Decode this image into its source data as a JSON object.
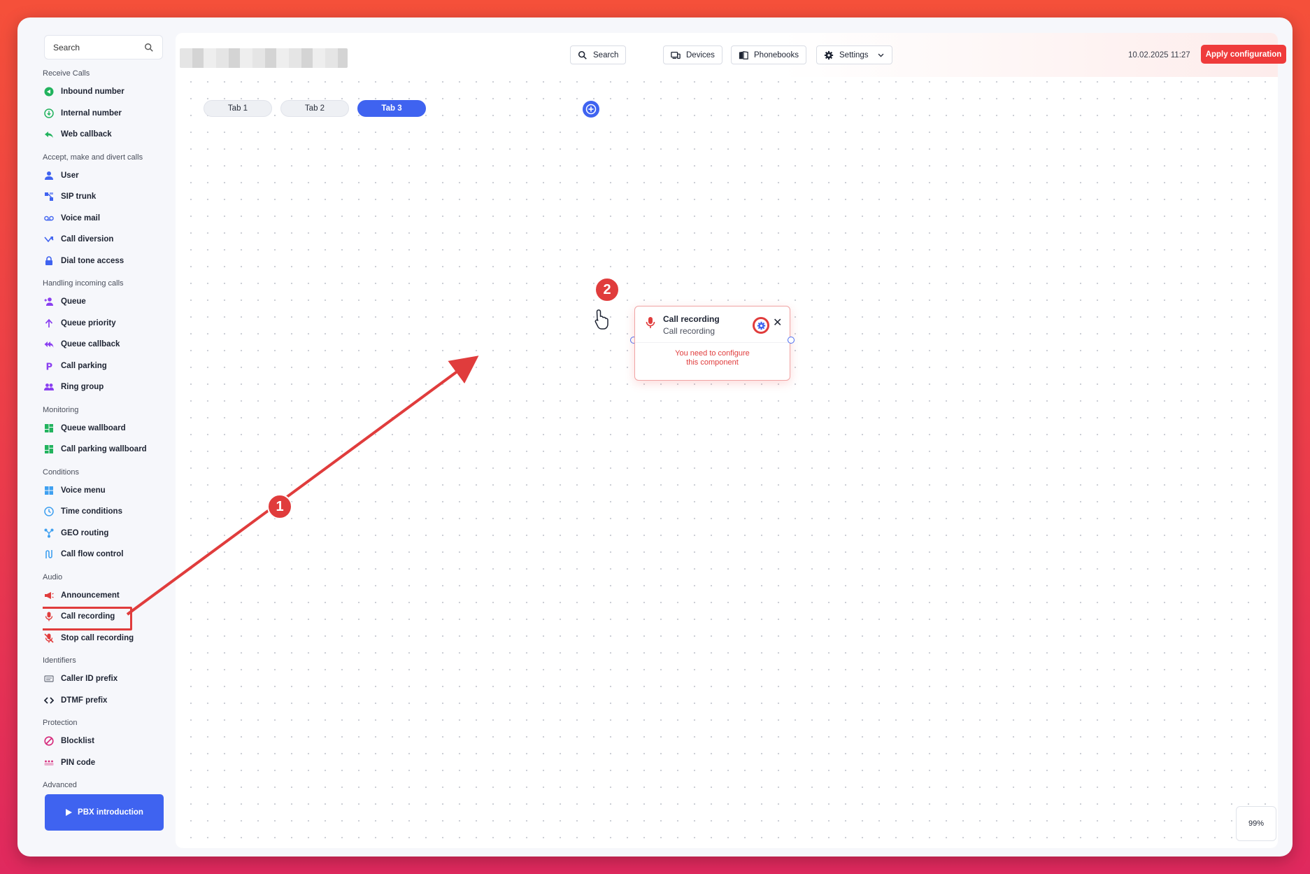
{
  "sidebar": {
    "search_placeholder": "Search",
    "sections": [
      {
        "title": "Receive Calls",
        "items": [
          {
            "label": "Inbound number",
            "icon": "inbound-number-icon",
            "color": "#22b35e"
          },
          {
            "label": "Internal number",
            "icon": "internal-number-icon",
            "color": "#22b35e"
          },
          {
            "label": "Web callback",
            "icon": "web-callback-icon",
            "color": "#22b35e"
          }
        ]
      },
      {
        "title": "Accept, make and divert calls",
        "items": [
          {
            "label": "User",
            "icon": "user-icon",
            "color": "#3f63f0"
          },
          {
            "label": "SIP trunk",
            "icon": "sip-trunk-icon",
            "color": "#3f63f0"
          },
          {
            "label": "Voice mail",
            "icon": "voice-mail-icon",
            "color": "#3f63f0"
          },
          {
            "label": "Call diversion",
            "icon": "call-diversion-icon",
            "color": "#3f63f0"
          },
          {
            "label": "Dial tone access",
            "icon": "lock-icon",
            "color": "#3f63f0"
          }
        ]
      },
      {
        "title": "Handling incoming calls",
        "items": [
          {
            "label": "Queue",
            "icon": "queue-icon",
            "color": "#8a3ff0"
          },
          {
            "label": "Queue priority",
            "icon": "queue-priority-icon",
            "color": "#8a3ff0"
          },
          {
            "label": "Queue callback",
            "icon": "queue-callback-icon",
            "color": "#8a3ff0"
          },
          {
            "label": "Call parking",
            "icon": "call-parking-icon",
            "color": "#8a3ff0"
          },
          {
            "label": "Ring group",
            "icon": "ring-group-icon",
            "color": "#8a3ff0"
          }
        ]
      },
      {
        "title": "Monitoring",
        "items": [
          {
            "label": "Queue wallboard",
            "icon": "wallboard-icon",
            "color": "#22b35e"
          },
          {
            "label": "Call parking wallboard",
            "icon": "wallboard-icon",
            "color": "#22b35e"
          }
        ]
      },
      {
        "title": "Conditions",
        "items": [
          {
            "label": "Voice menu",
            "icon": "voice-menu-icon",
            "color": "#3fa0f0"
          },
          {
            "label": "Time conditions",
            "icon": "clock-icon",
            "color": "#3fa0f0"
          },
          {
            "label": "GEO routing",
            "icon": "geo-routing-icon",
            "color": "#3fa0f0"
          },
          {
            "label": "Call flow control",
            "icon": "call-flow-control-icon",
            "color": "#3fa0f0"
          }
        ]
      },
      {
        "title": "Audio",
        "items": [
          {
            "label": "Announcement",
            "icon": "megaphone-icon",
            "color": "#e03c3c"
          },
          {
            "label": "Call recording",
            "icon": "microphone-icon",
            "color": "#e03c3c",
            "highlight": true
          },
          {
            "label": "Stop call recording",
            "icon": "microphone-off-icon",
            "color": "#e03c3c"
          }
        ]
      },
      {
        "title": "Identifiers",
        "items": [
          {
            "label": "Caller ID prefix",
            "icon": "caller-id-prefix-icon",
            "color": "#6a6f7c"
          },
          {
            "label": "DTMF prefix",
            "icon": "code-brackets-icon",
            "color": "#1e2433"
          }
        ]
      },
      {
        "title": "Protection",
        "items": [
          {
            "label": "Blocklist",
            "icon": "block-icon",
            "color": "#d6287a"
          },
          {
            "label": "PIN code",
            "icon": "pin-code-icon",
            "color": "#d6287a"
          }
        ]
      },
      {
        "title": "Advanced",
        "items": []
      }
    ],
    "pbx_button": "PBX introduction"
  },
  "toolbar": {
    "search": "Search",
    "devices": "Devices",
    "phonebooks": "Phonebooks",
    "settings": "Settings",
    "datetime": "10.02.2025 11:27",
    "apply": "Apply configuration"
  },
  "tabs": [
    {
      "label": "Tab 1",
      "active": false
    },
    {
      "label": "Tab 2",
      "active": false
    },
    {
      "label": "Tab 3",
      "active": true
    }
  ],
  "node": {
    "title": "Call recording",
    "subtitle": "Call recording",
    "warning_line1": "You need to configure",
    "warning_line2": "this component"
  },
  "zoom_level": "99%",
  "annotations": {
    "step1": "1",
    "step2": "2"
  },
  "colors": {
    "accent": "#3f63f0",
    "danger": "#ef3b3b"
  }
}
